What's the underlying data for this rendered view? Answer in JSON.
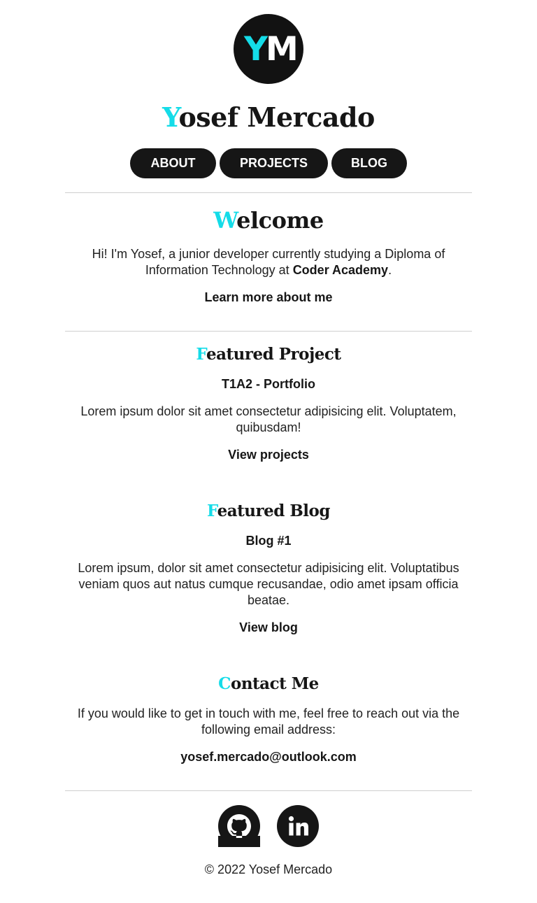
{
  "colors": {
    "accent": "#14dce8",
    "dark": "#161616",
    "background": "#ffffff",
    "rule": "#cfcfcf"
  },
  "logo": {
    "first": "Y",
    "second": "M"
  },
  "header": {
    "title_initial": "Y",
    "title_rest": "osef Mercado"
  },
  "nav": [
    {
      "label": "ABOUT"
    },
    {
      "label": "PROJECTS"
    },
    {
      "label": "BLOG"
    }
  ],
  "welcome": {
    "heading_initial": "W",
    "heading_rest": "elcome",
    "intro": "Hi! I'm Yosef, a junior developer currently studying a Diploma of Information Technology at ",
    "school": "Coder Academy",
    "intro_end": ".",
    "link": "Learn more about me"
  },
  "featured_project": {
    "heading_initial": "F",
    "heading_rest": "eatured Project",
    "title": "T1A2 - Portfolio",
    "description": "Lorem ipsum dolor sit amet consectetur adipisicing elit. Voluptatem, quibusdam!",
    "link": "View projects"
  },
  "featured_blog": {
    "heading_initial": "F",
    "heading_rest": "eatured Blog",
    "title": "Blog #1",
    "description": "Lorem ipsum, dolor sit amet consectetur adipisicing elit. Voluptatibus veniam quos aut natus cumque recusandae, odio amet ipsam officia beatae.",
    "link": "View blog"
  },
  "contact": {
    "heading_initial": "C",
    "heading_rest": "ontact Me",
    "text": "If you would like to get in touch with me, feel free to reach out via the following email address:",
    "email": "yosef.mercado@outlook.com"
  },
  "social": [
    {
      "icon": "github-icon"
    },
    {
      "icon": "linkedin-icon"
    }
  ],
  "footer": {
    "copyright": "© 2022 Yosef Mercado"
  }
}
